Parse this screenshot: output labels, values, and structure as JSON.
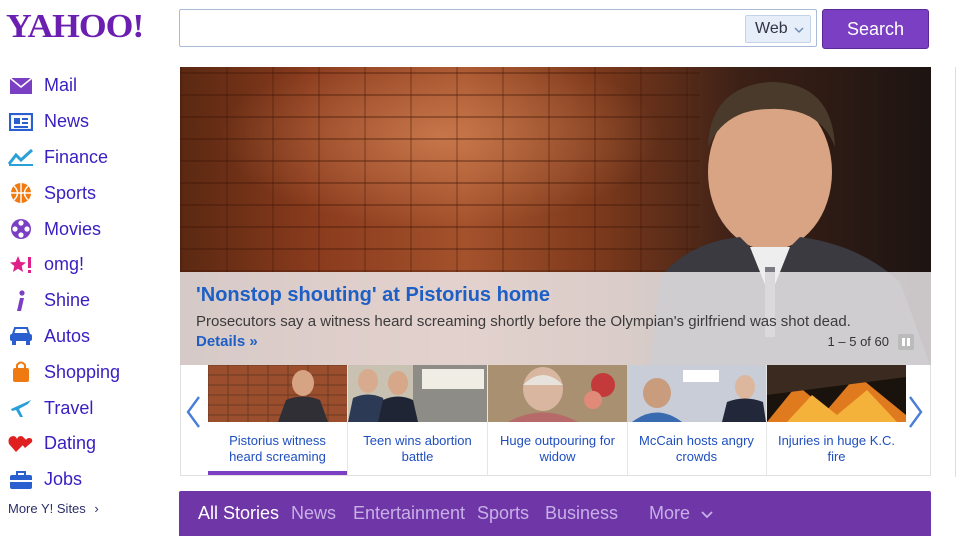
{
  "header": {
    "logo": "YAHOO!",
    "search_placeholder": "",
    "search_scope": "Web",
    "search_button": "Search"
  },
  "sidebar": {
    "items": [
      {
        "label": "Mail",
        "icon": "mail-icon",
        "color": "#7b3fc4"
      },
      {
        "label": "News",
        "icon": "news-icon",
        "color": "#2a5fd0"
      },
      {
        "label": "Finance",
        "icon": "finance-icon",
        "color": "#2aa0d8"
      },
      {
        "label": "Sports",
        "icon": "sports-icon",
        "color": "#f07a12"
      },
      {
        "label": "Movies",
        "icon": "movies-icon",
        "color": "#7b3fc4"
      },
      {
        "label": "omg!",
        "icon": "omg-icon",
        "color": "#e0208a"
      },
      {
        "label": "Shine",
        "icon": "shine-icon",
        "color": "#7b3fc4"
      },
      {
        "label": "Autos",
        "icon": "autos-icon",
        "color": "#2a5fd0"
      },
      {
        "label": "Shopping",
        "icon": "shopping-icon",
        "color": "#f07a12"
      },
      {
        "label": "Travel",
        "icon": "travel-icon",
        "color": "#2aa0d8"
      },
      {
        "label": "Dating",
        "icon": "dating-icon",
        "color": "#e02020"
      },
      {
        "label": "Jobs",
        "icon": "jobs-icon",
        "color": "#2a5fd0"
      }
    ],
    "more_sites": "More Y! Sites",
    "more_chevron": "›"
  },
  "hero": {
    "title": "'Nonstop shouting' at Pistorius home",
    "description": "Prosecutors say a witness heard screaming shortly before the Olympian's girlfriend was shot dead.",
    "details_link": "Details »",
    "count": "1 – 5 of 60"
  },
  "carousel": {
    "items": [
      {
        "caption": "Pistorius witness heard screaming",
        "active": true
      },
      {
        "caption": "Teen wins abortion battle",
        "active": false
      },
      {
        "caption": "Huge outpouring for widow",
        "active": false
      },
      {
        "caption": "McCain hosts angry crowds",
        "active": false
      },
      {
        "caption": "Injuries in huge K.C. fire",
        "active": false
      }
    ]
  },
  "tabs": [
    {
      "label": "All Stories",
      "active": true
    },
    {
      "label": "News",
      "active": false
    },
    {
      "label": "Entertainment",
      "active": false
    },
    {
      "label": "Sports",
      "active": false
    },
    {
      "label": "Business",
      "active": false
    },
    {
      "label": "More",
      "active": false
    }
  ],
  "colors": {
    "brand_purple": "#7b3fc4",
    "link_blue": "#1e5fc6"
  }
}
